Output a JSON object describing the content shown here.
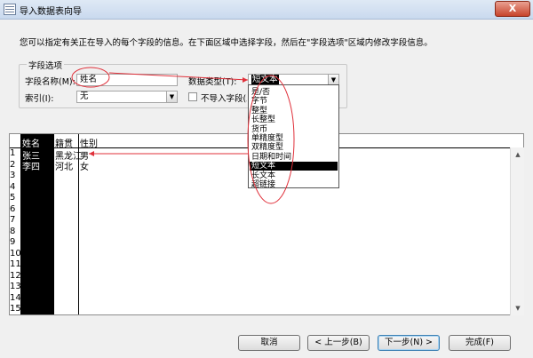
{
  "window": {
    "title": "导入数据表向导",
    "close_label": "X"
  },
  "instruction": "您可以指定有关正在导入的每个字段的信息。在下面区域中选择字段，然后在\"字段选项\"区域内修改字段信息。",
  "field_options": {
    "group_title": "字段选项",
    "field_name_label": "字段名称(M):",
    "field_name_value": "姓名",
    "data_type_label": "数据类型(T):",
    "data_type_value": "短文本",
    "index_label": "索引(I):",
    "index_value": "无",
    "skip_label": "不导入字段(跳过)(S)"
  },
  "data_type_options": [
    "是/否",
    "字节",
    "整型",
    "长整型",
    "货币",
    "单精度型",
    "双精度型",
    "日期和时间",
    "短文本",
    "长文本",
    "超链接"
  ],
  "data_type_selected_index": 8,
  "grid": {
    "columns": [
      "姓名",
      "籍贯",
      "性别"
    ],
    "rows": [
      [
        "张三",
        "黑龙江",
        "男"
      ],
      [
        "李四",
        "河北",
        "女"
      ]
    ],
    "row_numbers": [
      "1",
      "2",
      "3",
      "4",
      "5",
      "6",
      "7",
      "8",
      "9",
      "10",
      "11",
      "12",
      "13",
      "14",
      "15"
    ]
  },
  "buttons": {
    "cancel": "取消",
    "back": "< 上一步(B)",
    "next": "下一步(N) >",
    "finish": "完成(F)"
  },
  "colors": {
    "annotation": "#e0303a",
    "selection": "#000000"
  }
}
